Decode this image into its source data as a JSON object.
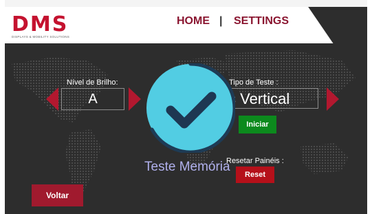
{
  "header": {
    "logo_text": "DMS",
    "logo_subtitle": "DISPLAYS & MOBILITY SOLUTIONS",
    "nav_home": "HOME",
    "nav_separator": "|",
    "nav_settings": "SETTINGS"
  },
  "brightness": {
    "label": "Nível de Brilho:",
    "value": "A"
  },
  "test_type": {
    "label": "Tipo de Teste :",
    "value_visible": "s Vertical",
    "start_button": "Iniciar"
  },
  "reset": {
    "label": "Resetar Painéis :",
    "button": "Reset"
  },
  "memory_label": "Teste Memória",
  "back_button": "Voltar",
  "success_overlay": {
    "icon": "checkmark-icon"
  },
  "colors": {
    "brand_red": "#c4122f",
    "nav_color": "#8a1530",
    "arrow_red": "#b3182f",
    "start_green": "#0c8a1d",
    "reset_red": "#b5101a",
    "back_red": "#a01a2e",
    "overlay_cyan": "#52cde3",
    "overlay_ring": "#1e3b55",
    "check_navy": "#1e3752",
    "background": "#2d2d2d"
  }
}
